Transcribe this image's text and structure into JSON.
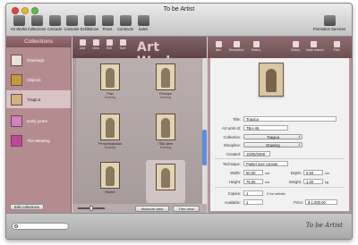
{
  "window": {
    "title": "To be Artist"
  },
  "toolbar": {
    "items": [
      {
        "label": "Art Works",
        "icon": "artworks-icon"
      },
      {
        "label": "Collections",
        "icon": "collections-icon"
      },
      {
        "label": "Contacts",
        "icon": "contacts-icon"
      },
      {
        "label": "Contents",
        "icon": "contents-icon"
      },
      {
        "label": "Exhibitions",
        "icon": "exhibitions-icon"
      },
      {
        "label": "Press",
        "icon": "press-icon"
      },
      {
        "label": "Contracts",
        "icon": "contracts-icon"
      },
      {
        "label": "Sales",
        "icon": "sales-icon"
      }
    ],
    "promotion_label": "Promotion Services"
  },
  "sidebar": {
    "header": "Collections",
    "items": [
      {
        "label": "Drawings",
        "selected": false
      },
      {
        "label": "Objects",
        "selected": false
      },
      {
        "label": "Tragica",
        "selected": true
      },
      {
        "label": "Early years",
        "selected": false
      },
      {
        "label": "The Meeting",
        "selected": false
      }
    ],
    "edit_button": "Edit collections"
  },
  "grid": {
    "title": "Art Works",
    "tools": [
      "Add",
      "View",
      "Edit",
      "Sort"
    ],
    "items": [
      {
        "title": "Plan",
        "sub": "Drawing"
      },
      {
        "title": "Principe",
        "sub": "Drawing"
      },
      {
        "title": "Persevirabilitad",
        "sub": "Drawing"
      },
      {
        "title": "TBA idem",
        "sub": "Drawing"
      },
      {
        "title": "Sketch",
        "sub": ""
      },
      {
        "title": "",
        "sub": ""
      }
    ],
    "footer_buttons": [
      "Museum view",
      "Tree view"
    ],
    "colors": {
      "header": "#6f5357",
      "panel": "#a99b9c",
      "scroll": "#5b8ee0"
    }
  },
  "detail": {
    "tabs": [
      "Item",
      "Description",
      "History",
      "Gallery",
      "Make artwork",
      "Print"
    ],
    "fields": {
      "title_label": "Title:",
      "title_value": "Tragica",
      "artwork_id_label": "Art work Id:",
      "artwork_id_value": "TBA-45",
      "collection_label": "Collection:",
      "collection_value": "Tragica",
      "discipline_label": "Discipline:",
      "discipline_value": "Drawing",
      "created_label": "Created:",
      "created_value": "15/05/2008",
      "technique_label": "Technique:",
      "technique_value": "Pastel over canvas",
      "width_label": "Width:",
      "width_value": "50,00",
      "width_unit": "cm",
      "depth_label": "Depth:",
      "depth_value": "0,50",
      "depth_unit": "cm",
      "height_label": "Height:",
      "height_value": "75,00",
      "height_unit": "cm",
      "weight_label": "Weight:",
      "weight_value": "1,00",
      "weight_unit": "kg",
      "copies_label": "Copies:",
      "copies_value": "1",
      "copies_note": "0 for infinite",
      "available_label": "Available:",
      "available_value": "1",
      "price_label": "Price:",
      "price_value": "$ 1.000,00"
    }
  },
  "bottombar": {
    "brand": "To be Artist"
  }
}
